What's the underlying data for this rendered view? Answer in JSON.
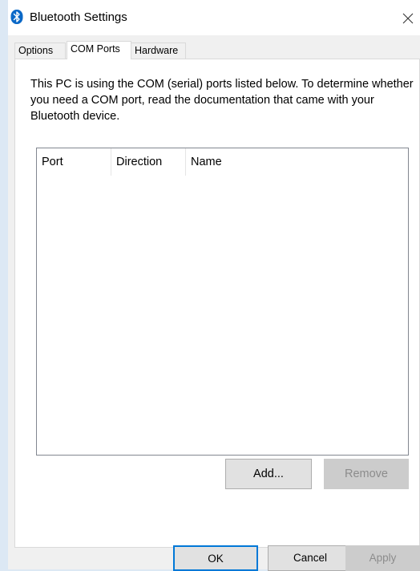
{
  "window": {
    "title": "Bluetooth Settings",
    "icon": "bluetooth-icon",
    "close_icon": "close-icon"
  },
  "tabs": [
    {
      "label": "Options",
      "active": false
    },
    {
      "label": "COM Ports",
      "active": true
    },
    {
      "label": "Hardware",
      "active": false
    }
  ],
  "com_ports": {
    "description": "This PC is using the COM (serial) ports listed below. To determine whether you need a COM port, read the documentation that came with your Bluetooth device.",
    "columns": [
      "Port",
      "Direction",
      "Name"
    ],
    "rows": [],
    "add_label": "Add...",
    "remove_label": "Remove"
  },
  "footer": {
    "ok_label": "OK",
    "cancel_label": "Cancel",
    "apply_label": "Apply"
  },
  "colors": {
    "accent": "#0078d7",
    "bluetooth": "#0a68c7",
    "disabled_text": "#8c8c8c"
  }
}
